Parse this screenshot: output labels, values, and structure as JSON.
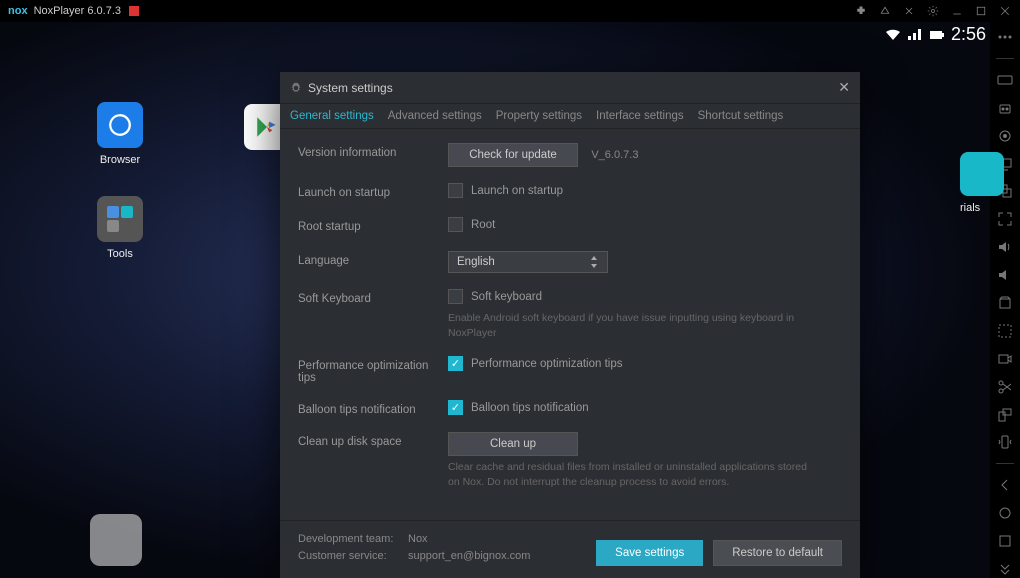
{
  "titlebar": {
    "logo": "nox",
    "app_name": "NoxPlayer 6.0.7.3"
  },
  "statusbar": {
    "time": "2:56"
  },
  "desktop": {
    "browser_label": "Browser",
    "tools_label": "Tools",
    "right_partial_label": "rials"
  },
  "modal": {
    "title": "System settings",
    "tabs": {
      "general": "General settings",
      "advanced": "Advanced settings",
      "property": "Property settings",
      "interface": "Interface settings",
      "shortcut": "Shortcut settings"
    },
    "rows": {
      "version_label": "Version information",
      "check_update_btn": "Check for update",
      "version_value": "V_6.0.7.3",
      "launch_startup_label": "Launch on startup",
      "launch_startup_cb": "Launch on startup",
      "root_startup_label": "Root startup",
      "root_cb": "Root",
      "language_label": "Language",
      "language_value": "English",
      "soft_kb_label": "Soft Keyboard",
      "soft_kb_cb": "Soft keyboard",
      "soft_kb_hint": "Enable Android soft keyboard if you have issue inputting using keyboard in NoxPlayer",
      "perf_tips_label": "Performance optimization tips",
      "perf_tips_cb": "Performance optimization tips",
      "balloon_label": "Balloon tips notification",
      "balloon_cb": "Balloon tips notification",
      "cleanup_label": "Clean up disk space",
      "cleanup_btn": "Clean up",
      "cleanup_hint": "Clear cache and residual files from installed or uninstalled applications stored on Nox. Do not interrupt the cleanup process to avoid errors."
    },
    "footer": {
      "dev_team_label": "Development team:",
      "dev_team_value": "Nox",
      "cs_label": "Customer service:",
      "cs_value": "support_en@bignox.com",
      "save_btn": "Save settings",
      "restore_btn": "Restore to default"
    }
  }
}
